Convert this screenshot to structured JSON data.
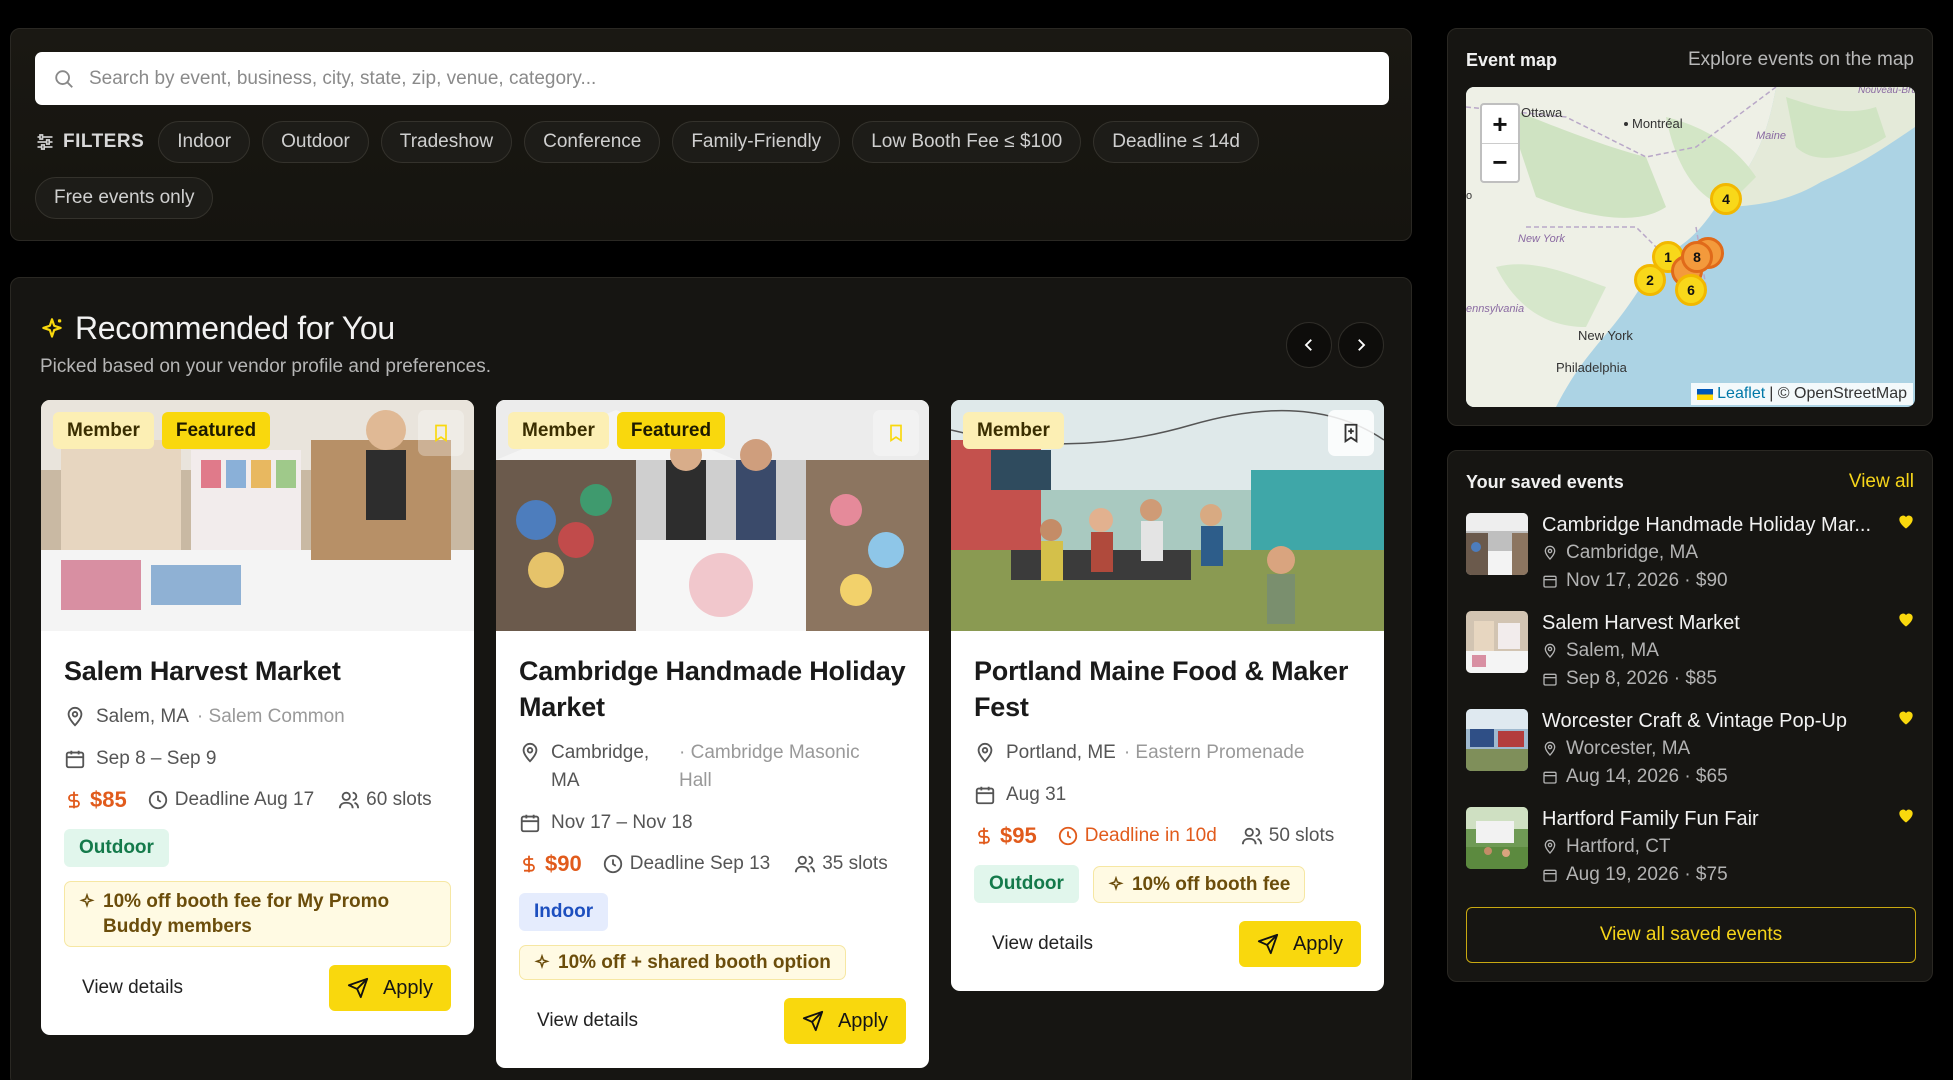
{
  "search": {
    "placeholder": "Search by event, business, city, state, zip, venue, category...",
    "filters_label": "FILTERS",
    "chips": [
      "Indoor",
      "Outdoor",
      "Tradeshow",
      "Conference",
      "Family-Friendly",
      "Low Booth Fee ≤ $100",
      "Deadline ≤ 14d",
      "Free events only"
    ]
  },
  "recommended": {
    "title": "Recommended for You",
    "subtitle": "Picked based on your vendor profile and preferences.",
    "cards": [
      {
        "badges": [
          "Member",
          "Featured"
        ],
        "title": "Salem Harvest Market",
        "city": "Salem, MA",
        "venue": "· Salem Common",
        "dates": "Sep 8 – Sep 9",
        "price": "$85",
        "deadline": "Deadline Aug 17",
        "slots": "60 slots",
        "tag": "Outdoor",
        "promo": "10% off booth fee for My Promo Buddy members",
        "view": "View details",
        "apply": "Apply"
      },
      {
        "badges": [
          "Member",
          "Featured"
        ],
        "title": "Cambridge Handmade Holiday Market",
        "city": "Cambridge, MA",
        "venue": "· Cambridge Masonic Hall",
        "dates": "Nov 17 – Nov 18",
        "price": "$90",
        "deadline": "Deadline Sep 13",
        "slots": "35 slots",
        "tag": "Indoor",
        "promo": "10% off + shared booth option",
        "view": "View details",
        "apply": "Apply"
      },
      {
        "badges": [
          "Member"
        ],
        "title": "Portland Maine Food & Maker Fest",
        "city": "Portland, ME",
        "venue": "· Eastern Promenade",
        "dates": "Aug 31",
        "price": "$95",
        "deadline": "Deadline in 10d",
        "slots": "50 slots",
        "tag": "Outdoor",
        "promo": "10% off booth fee",
        "view": "View details",
        "apply": "Apply"
      }
    ]
  },
  "map": {
    "title": "Event map",
    "link": "Explore events on the map",
    "zoom_in": "+",
    "zoom_out": "−",
    "attribution_leaflet": "Leaflet",
    "attribution_rest": "| © OpenStreetMap",
    "place_labels": [
      "Ottawa",
      "Montréal",
      "Maine",
      "Nouveau-Brunswick",
      "New York",
      "ennsylvania",
      "New York",
      "Philadelphia",
      "o"
    ],
    "clusters": [
      "4",
      "1",
      "8",
      "2",
      "6"
    ]
  },
  "saved": {
    "title": "Your saved events",
    "view_all": "View all",
    "items": [
      {
        "name": "Cambridge Handmade Holiday Mar...",
        "city": "Cambridge, MA",
        "date_price": "Nov 17, 2026 · $90"
      },
      {
        "name": "Salem Harvest Market",
        "city": "Salem, MA",
        "date_price": "Sep 8, 2026 · $85"
      },
      {
        "name": "Worcester Craft & Vintage Pop-Up",
        "city": "Worcester, MA",
        "date_price": "Aug 14, 2026 · $65"
      },
      {
        "name": "Hartford Family Fun Fair",
        "city": "Hartford, CT",
        "date_price": "Aug 19, 2026 · $75"
      }
    ],
    "button": "View all saved events"
  },
  "colors": {
    "accent": "#f9d80d",
    "price": "#e15b1c",
    "outdoor": "#147a4b",
    "indoor": "#1d4fbf"
  }
}
